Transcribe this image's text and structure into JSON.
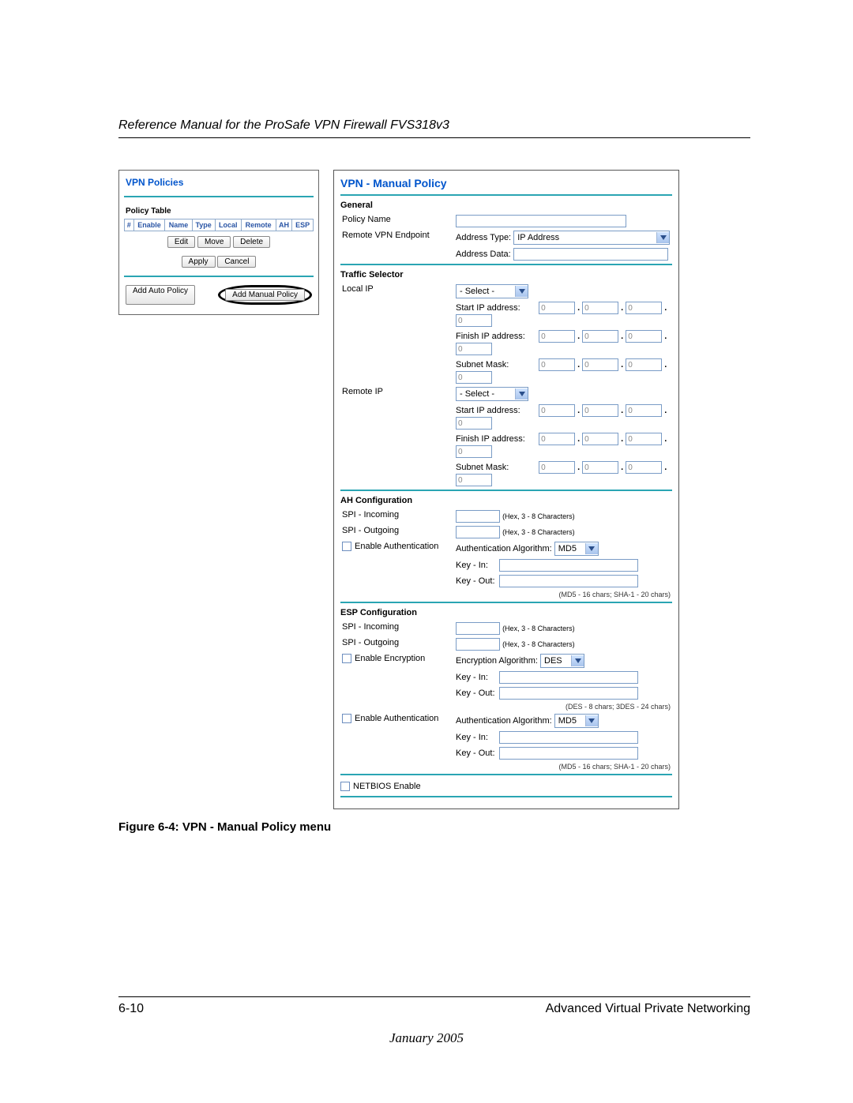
{
  "doc": {
    "running_head": "Reference Manual for the ProSafe VPN Firewall FVS318v3",
    "figure_caption": "Figure 6-4: VPN - Manual Policy menu",
    "page_number": "6-10",
    "section_title": "Advanced Virtual Private Networking",
    "pub_date": "January 2005"
  },
  "policies_panel": {
    "title": "VPN Policies",
    "table_label": "Policy Table",
    "columns": [
      "#",
      "Enable",
      "Name",
      "Type",
      "Local",
      "Remote",
      "AH",
      "ESP"
    ],
    "btn_edit": "Edit",
    "btn_move": "Move",
    "btn_delete": "Delete",
    "btn_apply": "Apply",
    "btn_cancel": "Cancel",
    "btn_add_auto": "Add Auto Policy",
    "btn_add_manual": "Add Manual Policy"
  },
  "manual_panel": {
    "title": "VPN - Manual Policy",
    "sec_general": "General",
    "lbl_policy_name": "Policy Name",
    "lbl_remote_endpoint": "Remote VPN Endpoint",
    "lbl_addr_type": "Address Type:",
    "val_addr_type": "IP Address",
    "lbl_addr_data": "Address Data:",
    "sec_traffic": "Traffic Selector",
    "lbl_local_ip": "Local IP",
    "lbl_remote_ip": "Remote IP",
    "sel_placeholder": "- Select -",
    "lbl_start_ip": "Start IP address:",
    "lbl_finish_ip": "Finish IP address:",
    "lbl_subnet": "Subnet Mask:",
    "octet_placeholder": "0",
    "sec_ah": "AH Configuration",
    "lbl_spi_in": "SPI - Incoming",
    "lbl_spi_out": "SPI - Outgoing",
    "hint_hex": "(Hex, 3 - 8 Characters)",
    "lbl_enable_auth": "Enable Authentication",
    "lbl_auth_algo": "Authentication Algorithm:",
    "val_auth_algo": "MD5",
    "lbl_key_in": "Key - In:",
    "lbl_key_out": "Key - Out:",
    "note_md5": "(MD5 - 16 chars;   SHA-1 - 20 chars)",
    "sec_esp": "ESP Configuration",
    "lbl_enable_enc": "Enable Encryption",
    "lbl_enc_algo": "Encryption Algorithm:",
    "val_enc_algo": "DES",
    "note_des": "(DES - 8 chars;   3DES - 24 chars)",
    "lbl_netbios": "NETBIOS Enable"
  }
}
